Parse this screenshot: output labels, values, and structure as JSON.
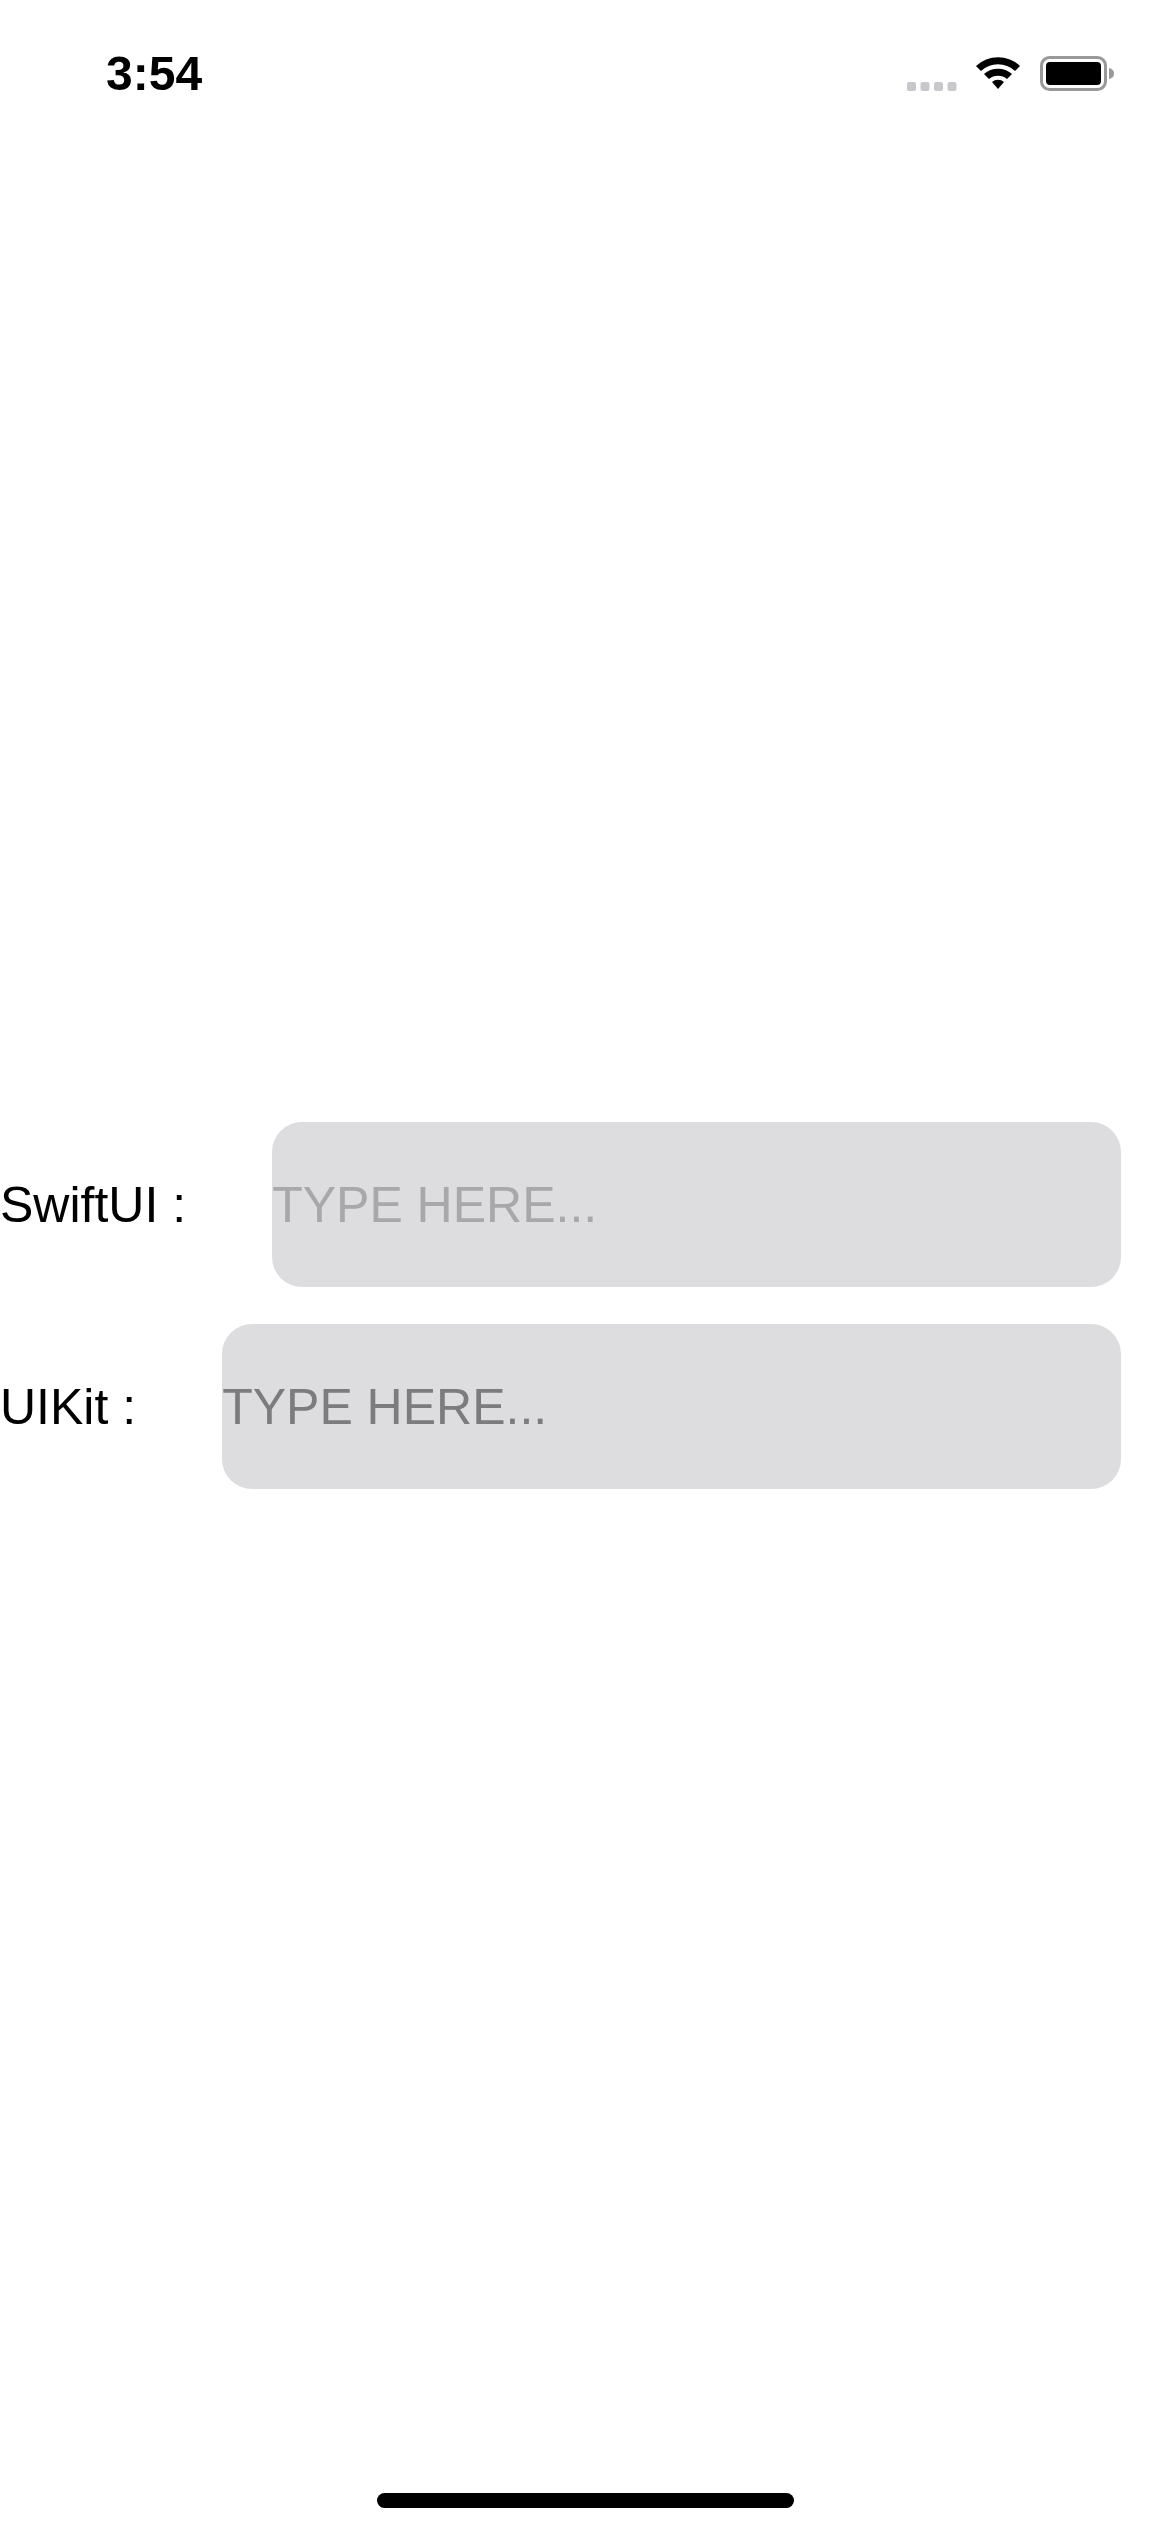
{
  "status_bar": {
    "time": "3:54"
  },
  "fields": [
    {
      "kind": "swiftui",
      "label": "SwiftUI :",
      "placeholder": "TYPE HERE..."
    },
    {
      "kind": "uikit",
      "label": "UIKit :",
      "placeholder": "TYPE HERE..."
    }
  ]
}
